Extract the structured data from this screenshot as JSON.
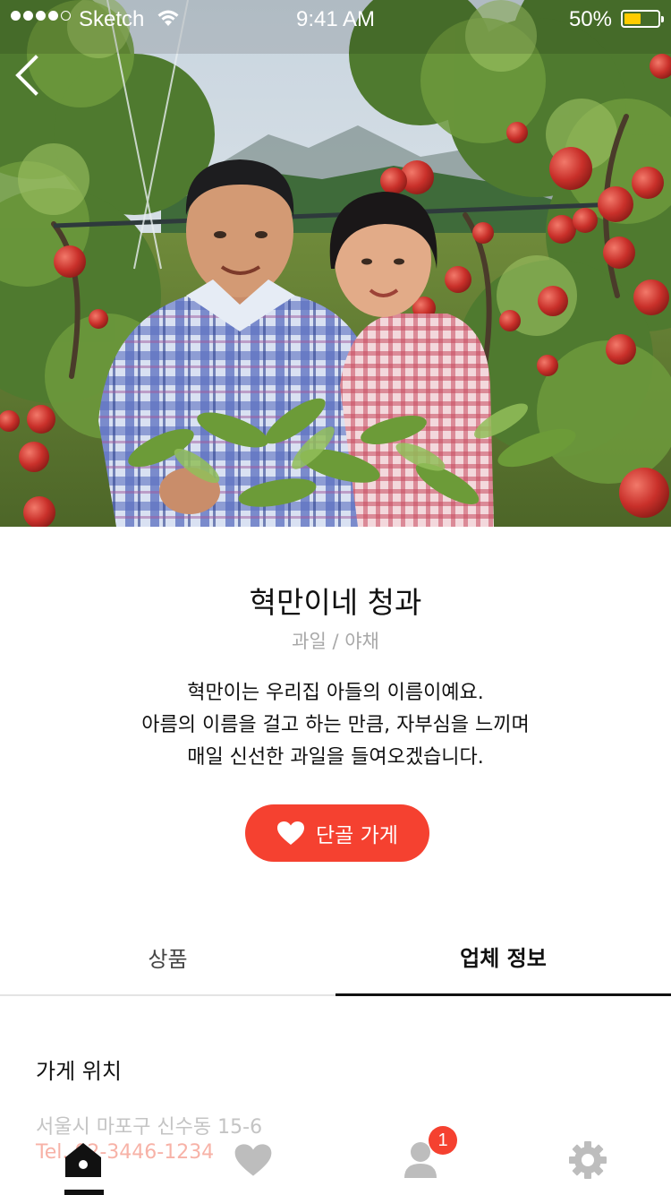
{
  "status_bar": {
    "carrier": "Sketch",
    "time": "9:41 AM",
    "battery_percent": "50%",
    "battery_level": 0.5,
    "signal_bars_filled": 4,
    "signal_bars_total": 5
  },
  "nav": {
    "back_icon": "chevron-left-icon"
  },
  "store": {
    "name": "혁만이네 청과",
    "category": "과일 / 야채",
    "description": [
      "혁만이는 우리집 아들의 이름이예요.",
      "아름의 이름을 걸고 하는 만큼, 자부심을 느끼며",
      "매일 신선한 과일을 들여오겠습니다."
    ],
    "favorite_button_label": "단골 가게",
    "favorite_icon": "heart-icon"
  },
  "tabs": [
    {
      "label": "상품",
      "active": false
    },
    {
      "label": "업체 정보",
      "active": true
    }
  ],
  "location": {
    "title": "가게 위치",
    "address": "서울시 마포구 신수동 15-6",
    "phone": "Tel. 02-3446-1234"
  },
  "tabbar": {
    "items": [
      {
        "icon": "home-icon",
        "active": true
      },
      {
        "icon": "heart-icon",
        "active": false
      },
      {
        "icon": "user-icon",
        "active": false,
        "badge": "1"
      },
      {
        "icon": "gear-icon",
        "active": false
      }
    ]
  },
  "colors": {
    "accent": "#f54130",
    "muted_text": "#a8a8a8",
    "inactive_icon": "#bdbdbd",
    "battery": "#ffcc00"
  }
}
